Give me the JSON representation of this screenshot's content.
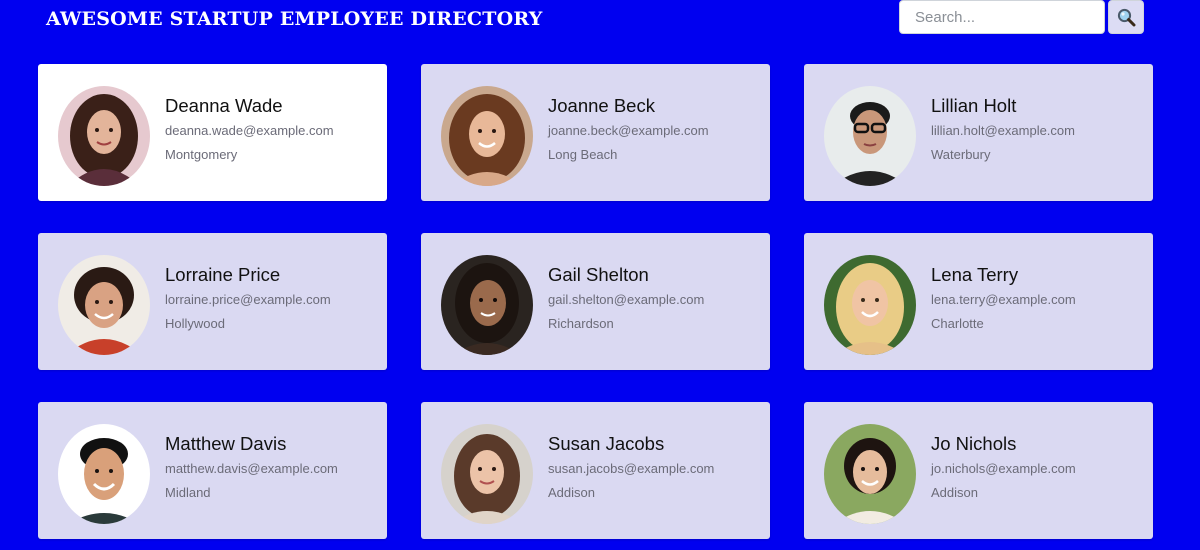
{
  "header": {
    "title": "AWESOME STARTUP EMPLOYEE DIRECTORY",
    "search": {
      "placeholder": "Search...",
      "value": ""
    },
    "search_button_icon": "magnifier-icon"
  },
  "employees": [
    {
      "name": "Deanna Wade",
      "email": "deanna.wade@example.com",
      "city": "Montgomery",
      "avatar": "avatar-photo-icon",
      "selected": true
    },
    {
      "name": "Joanne Beck",
      "email": "joanne.beck@example.com",
      "city": "Long Beach",
      "avatar": "avatar-photo-icon"
    },
    {
      "name": "Lillian Holt",
      "email": "lillian.holt@example.com",
      "city": "Waterbury",
      "avatar": "avatar-photo-icon"
    },
    {
      "name": "Lorraine Price",
      "email": "lorraine.price@example.com",
      "city": "Hollywood",
      "avatar": "avatar-photo-icon"
    },
    {
      "name": "Gail Shelton",
      "email": "gail.shelton@example.com",
      "city": "Richardson",
      "avatar": "avatar-photo-icon"
    },
    {
      "name": "Lena Terry",
      "email": "lena.terry@example.com",
      "city": "Charlotte",
      "avatar": "avatar-photo-icon"
    },
    {
      "name": "Matthew Davis",
      "email": "matthew.davis@example.com",
      "city": "Midland",
      "avatar": "avatar-photo-icon"
    },
    {
      "name": "Susan Jacobs",
      "email": "susan.jacobs@example.com",
      "city": "Addison",
      "avatar": "avatar-photo-icon"
    },
    {
      "name": "Jo Nichols",
      "email": "jo.nichols@example.com",
      "city": "Addison",
      "avatar": "avatar-photo-icon"
    }
  ],
  "colors": {
    "page_background": "#0000f0",
    "card_background": "#dad9f2",
    "selected_card_background": "#ffffff",
    "title_text": "#ffffff"
  }
}
